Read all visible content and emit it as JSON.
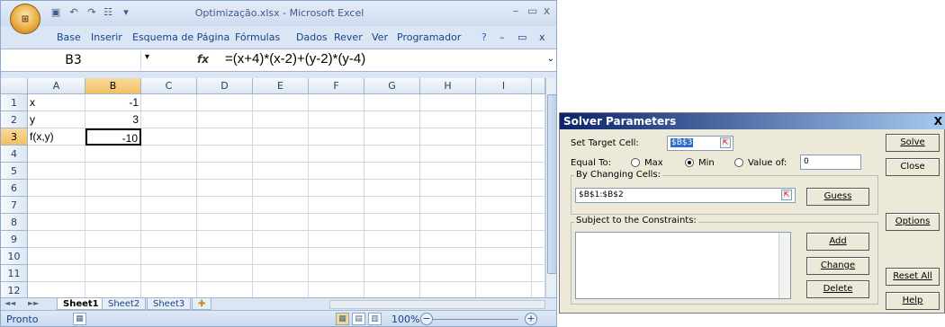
{
  "excel": {
    "window_title": "Optimização.xlsx - Microsoft Excel",
    "office_button": "Office",
    "window_controls": {
      "minimize": "–",
      "maximize": "▭",
      "close": "x"
    },
    "ribbon_tabs": [
      "Base",
      "Inserir",
      "Esquema de Página",
      "Fórmulas",
      "Dados",
      "Rever",
      "Ver",
      "Programador"
    ],
    "ribbon_controls": {
      "help": "?",
      "minimize": "–",
      "restore": "▭",
      "close": "x"
    },
    "name_box": "B3",
    "fx_label": "fx",
    "formula": "=(x+4)*(x-2)+(y-2)*(y-4)",
    "columns": [
      "A",
      "B",
      "C",
      "D",
      "E",
      "F",
      "G",
      "H",
      "I"
    ],
    "rows": [
      "1",
      "2",
      "3",
      "4",
      "5",
      "6",
      "7",
      "8",
      "9",
      "10",
      "11",
      "12"
    ],
    "cells": {
      "A1": "x",
      "B1": "-1",
      "A2": "y",
      "B2": "3",
      "A3": "f(x,y)",
      "B3": "-10"
    },
    "sheet_tabs": [
      "Sheet1",
      "Sheet2",
      "Sheet3"
    ],
    "active_sheet": "Sheet1",
    "status": "Pronto",
    "zoom": "100%"
  },
  "solver": {
    "title": "Solver Parameters",
    "close": "X",
    "set_target_label": "Set Target Cell:",
    "target_cell": "$B$3",
    "equal_to_label": "Equal To:",
    "options_max": "Max",
    "options_min": "Min",
    "options_value": "Value of:",
    "selected_option": "Min",
    "value_of": "0",
    "changing_label": "By Changing Cells:",
    "changing_cells": "$B$1:$B$2",
    "constraints_label": "Subject to the Constraints:",
    "buttons": {
      "solve": "Solve",
      "close": "Close",
      "guess": "Guess",
      "options": "Options",
      "add": "Add",
      "change": "Change",
      "delete": "Delete",
      "reset": "Reset All",
      "help": "Help"
    }
  }
}
